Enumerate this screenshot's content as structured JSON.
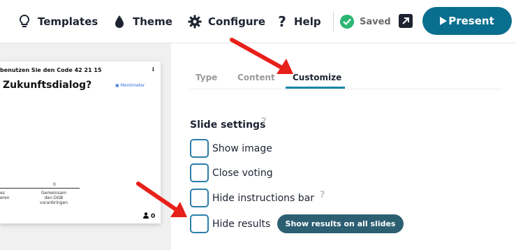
{
  "toolbar": {
    "templates_label": "Templates",
    "theme_label": "Theme",
    "configure_label": "Configure",
    "help_label": "Help",
    "saved_label": "Saved",
    "present_label": "Present",
    "icons": {
      "templates": "lightbulb-icon",
      "theme": "drop-icon",
      "configure": "gear-icon",
      "help": "question-icon",
      "saved": "check-circle-icon",
      "external": "external-link-icon",
      "present": "play-icon"
    }
  },
  "slide_preview": {
    "code_prefix": "benutzen Sie den Code",
    "code": "42 21 15",
    "info": "i",
    "question": "Zukunftsdialog?",
    "brand": "Mentimeter",
    "bar_count": "0",
    "label_left": "es\neren",
    "label_middle": "Gemeinsam\nden DGB\nvoranbringen",
    "responses": "0"
  },
  "tabs": {
    "type": "Type",
    "content": "Content",
    "customize": "Customize",
    "active": "Customize"
  },
  "slide_settings": {
    "title": "Slide settings",
    "help": "?",
    "options": [
      {
        "label": "Show image",
        "checked": false
      },
      {
        "label": "Close voting",
        "checked": false
      },
      {
        "label": "Hide instructions bar",
        "checked": false,
        "help": "?"
      },
      {
        "label": "Hide results",
        "checked": false
      }
    ],
    "show_results_all_label": "Show results on all slides"
  },
  "colors": {
    "accent": "#0a6e8e",
    "checkbox_border": "#2a7fa8",
    "tab_underline": "#1b86a8",
    "show_all_button": "#2d5f73",
    "saved_check": "#2bb673",
    "annotation_arrow": "#e8201a"
  }
}
